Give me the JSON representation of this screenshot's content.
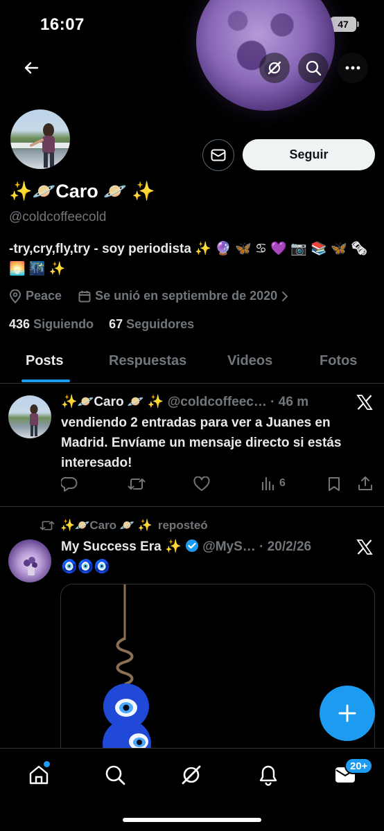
{
  "status_bar": {
    "time": "16:07",
    "battery": "47"
  },
  "profile": {
    "display_name": "✨🪐Caro 🪐 ✨",
    "handle": "@coldcoffeecold",
    "bio": "-try,cry,fly,try - soy periodista ✨ 🔮 🦋 ♋ 💜 📷 📚 🦋 🗞 🌅 🌃 ✨",
    "location": "Peace",
    "joined": "Se unió en septiembre de 2020",
    "following_count": "436",
    "following_label": "Siguiendo",
    "followers_count": "67",
    "followers_label": "Seguidores",
    "follow_button": "Seguir"
  },
  "tabs": [
    {
      "label": "Posts",
      "active": true
    },
    {
      "label": "Respuestas",
      "active": false
    },
    {
      "label": "Videos",
      "active": false
    },
    {
      "label": "Fotos",
      "active": false
    }
  ],
  "tweets": [
    {
      "author": "✨🪐Caro 🪐 ✨",
      "handle": "@coldcoffeec…",
      "time": "· 46 m",
      "text": "vendiendo 2 entradas para ver a Juanes en Madrid. Envíame un mensaje directo si estás interesado!",
      "views": "6"
    },
    {
      "repost_author": "✨🪐Caro 🪐 ✨",
      "repost_label": "reposteó",
      "author": "My Success Era ✨",
      "handle": "@MyS…",
      "time": "· 20/2/26",
      "text": "🧿🧿🧿"
    }
  ],
  "bottom_nav": {
    "notifications_badge": "20+"
  },
  "colors": {
    "accent": "#1d9bf0",
    "muted": "#71767b",
    "divider": "#2f3336"
  }
}
